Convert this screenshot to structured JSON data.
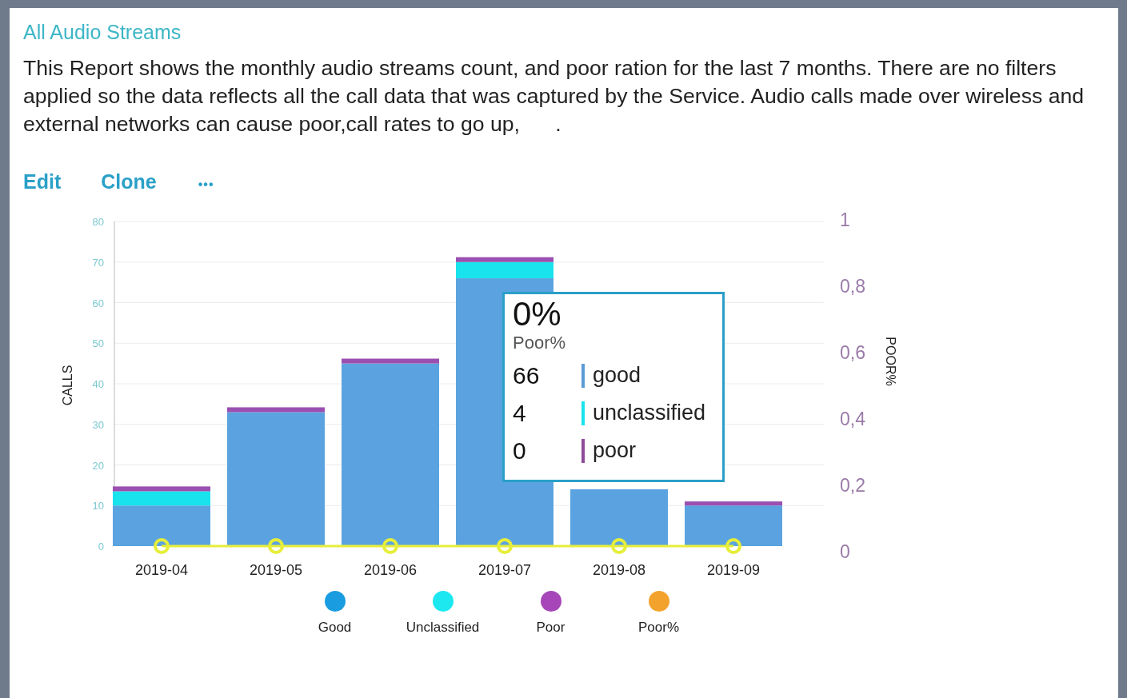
{
  "report": {
    "title": "All Audio Streams",
    "description": "This Report shows the monthly audio streams count, and poor ration for the last 7 months. There are no filters applied so the data reflects all the call data that was captured by the Service. Audio calls made over wireless and external networks can cause poor,call rates to go up,      .",
    "actions": [
      {
        "label": "Edit"
      },
      {
        "label": "Clone"
      },
      {
        "label": "•••"
      }
    ]
  },
  "chart": {
    "chart_data": {
      "type": "bar",
      "stacked": true,
      "grid": true,
      "ylabel": "CALLS",
      "categories": [
        "2019-04",
        "2019-05",
        "2019-06",
        "2019-07",
        "2019-08",
        "2019-09"
      ],
      "ylim": [
        0,
        80
      ],
      "yticks": [
        0,
        10,
        20,
        30,
        40,
        50,
        60,
        70,
        80
      ],
      "series": [
        {
          "name": "Good",
          "color": "#5ba3e0",
          "values": [
            10,
            33,
            45,
            66,
            14,
            10
          ]
        },
        {
          "name": "Unclassified",
          "color": "#19e3ec",
          "values": [
            3.5,
            0,
            0,
            4,
            0,
            0
          ]
        },
        {
          "name": "Poor",
          "color": "#9b4fb0",
          "values": [
            1.2,
            1.2,
            1.2,
            1.2,
            0,
            1
          ]
        },
        {
          "name": "Poor%",
          "type": "line",
          "marker": "circle",
          "color": "#e6ee3a",
          "values": [
            0,
            0,
            0,
            0,
            0,
            0
          ]
        }
      ]
    },
    "legend": [
      {
        "color": "#1a9de0"
      },
      {
        "color": "#1de8f0"
      },
      {
        "color": "#a646b8"
      },
      {
        "color": "#f3a32c"
      }
    ],
    "right_axis": {
      "label": "POOR%",
      "ticks": [
        "1",
        "0,8",
        "0,6",
        "0,4",
        "0,2",
        "0"
      ]
    },
    "tooltip": {
      "value": "0%",
      "label": "Poor%",
      "rows": [
        {
          "value": "66",
          "label": "good",
          "color": "#5b9bd5"
        },
        {
          "value": "4",
          "label": "unclassified",
          "color": "#19e3ec"
        },
        {
          "value": "0",
          "label": "poor",
          "color": "#8e4a9a"
        }
      ]
    }
  }
}
